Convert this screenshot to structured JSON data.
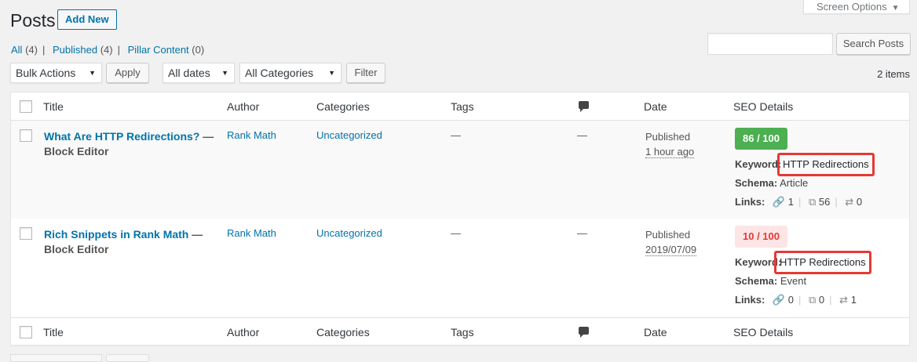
{
  "screen_options": {
    "label": "Screen Options"
  },
  "page": {
    "title": "Posts",
    "add_new": "Add New"
  },
  "views": [
    {
      "label": "All",
      "count": "(4)"
    },
    {
      "label": "Published",
      "count": "(4)"
    },
    {
      "label": "Pillar Content",
      "count": "(0)"
    }
  ],
  "search": {
    "placeholder": "",
    "button": "Search Posts"
  },
  "filters": {
    "bulk_actions": "Bulk Actions",
    "apply": "Apply",
    "dates": "All dates",
    "categories": "All Categories",
    "filter": "Filter",
    "items_count": "2 items"
  },
  "columns": {
    "title": "Title",
    "author": "Author",
    "categories": "Categories",
    "tags": "Tags",
    "date": "Date",
    "seo": "SEO Details"
  },
  "rows": [
    {
      "title": "What Are HTTP Redirections?",
      "state": "Block Editor",
      "author": "Rank Math",
      "category": "Uncategorized",
      "tags": "—",
      "comments": "—",
      "date_status": "Published",
      "date_when": "1 hour ago",
      "score": "86 / 100",
      "keyword_label": "Keyword:",
      "keyword": "HTTP Redirections",
      "schema_label": "Schema:",
      "schema": "Article",
      "links_label": "Links:",
      "internal_links": "1",
      "external_links": "56",
      "incoming_links": "0"
    },
    {
      "title": "Rich Snippets in Rank Math",
      "state": "Block Editor",
      "author": "Rank Math",
      "category": "Uncategorized",
      "tags": "—",
      "comments": "—",
      "date_status": "Published",
      "date_when": "2019/07/09",
      "score": "10 / 100",
      "keyword_label": "Keyword:",
      "keyword": "HTTP Redirections",
      "schema_label": "Schema:",
      "schema": "Event",
      "links_label": "Links:",
      "internal_links": "0",
      "external_links": "0",
      "incoming_links": "1"
    }
  ],
  "title_separator": " —",
  "colors": {
    "accent": "#0073aa",
    "good": "#4caf50",
    "bad": "#e53935",
    "highlight": "#e53935"
  },
  "icons": {
    "comment": "comment-bubble-icon",
    "link": "link-icon",
    "external": "external-link-icon",
    "incoming": "shuffle-icon"
  }
}
